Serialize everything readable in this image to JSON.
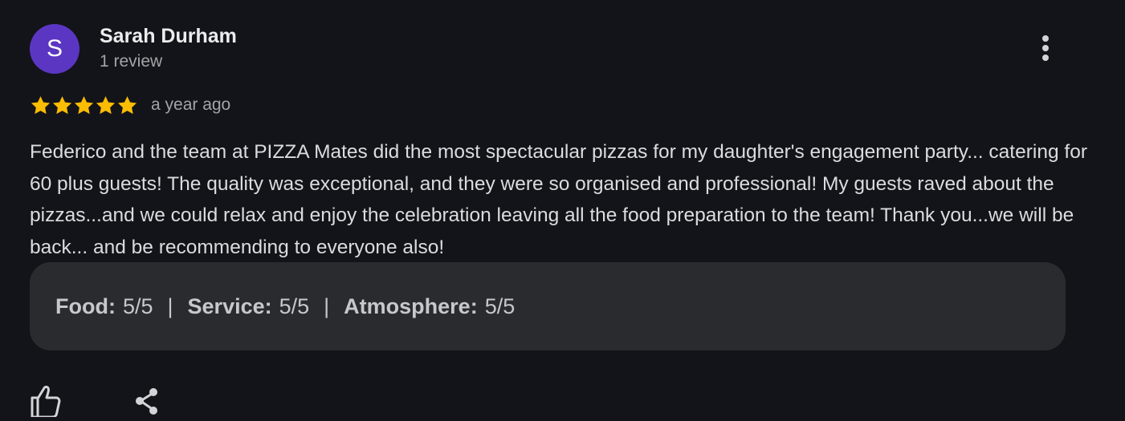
{
  "review": {
    "author": {
      "initial": "S",
      "name": "Sarah Durham",
      "meta": "1 review",
      "avatar_color": "#5b36c2"
    },
    "rating": 5,
    "rating_max": 5,
    "star_color": "#fbbc04",
    "date": "a year ago",
    "text": "Federico and the team at PIZZA Mates did the most spectacular pizzas for my daughter's engagement party... catering for 60 plus guests! The quality was exceptional, and they were so organised and professional! My guests raved about the pizzas...and we could relax and enjoy the celebration leaving all the food preparation to the team! Thank you...we will be back... and be recommending to everyone also!",
    "sub_ratings": [
      {
        "label": "Food:",
        "value": "5/5"
      },
      {
        "label": "Service:",
        "value": "5/5"
      },
      {
        "label": "Atmosphere:",
        "value": "5/5"
      }
    ],
    "separator": "|",
    "actions": {
      "more_icon": "more-vertical-icon",
      "like_icon": "thumbs-up-icon",
      "share_icon": "share-icon"
    }
  }
}
